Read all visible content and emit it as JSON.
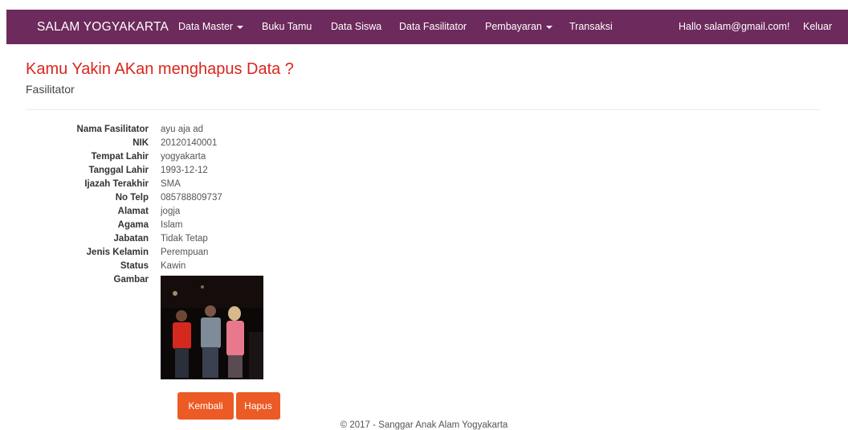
{
  "navbar": {
    "brand": "SALAM YOGYAKARTA",
    "items": [
      {
        "label": "Data Master",
        "dropdown": true
      },
      {
        "label": "Buku Tamu",
        "dropdown": false
      },
      {
        "label": "Data Siswa",
        "dropdown": false
      },
      {
        "label": "Data Fasilitator",
        "dropdown": false
      },
      {
        "label": "Pembayaran",
        "dropdown": true
      },
      {
        "label": "Transaksi",
        "dropdown": false
      }
    ],
    "greeting": "Hallo salam@gmail.com!",
    "logout": "Keluar"
  },
  "page": {
    "title": "Kamu Yakin AKan menghapus Data ?",
    "subtitle": "Fasilitator"
  },
  "detail": {
    "fields": [
      {
        "label": "Nama Fasilitator",
        "value": "ayu aja ad"
      },
      {
        "label": "NIK",
        "value": "20120140001"
      },
      {
        "label": "Tempat Lahir",
        "value": "yogyakarta"
      },
      {
        "label": "Tanggal Lahir",
        "value": "1993-12-12"
      },
      {
        "label": "Ijazah Terakhir",
        "value": "SMA"
      },
      {
        "label": "No Telp",
        "value": "085788809737"
      },
      {
        "label": "Alamat",
        "value": "jogja"
      },
      {
        "label": "Agama",
        "value": "Islam"
      },
      {
        "label": "Jabatan",
        "value": "Tidak Tetap"
      },
      {
        "label": "Jenis Kelamin",
        "value": "Perempuan"
      },
      {
        "label": "Status",
        "value": "Kawin"
      }
    ],
    "image_label": "Gambar"
  },
  "actions": {
    "back": "Kembali",
    "delete": "Hapus"
  },
  "footer": {
    "text": "© 2017 - Sanggar Anak Alam Yogyakarta"
  },
  "colors": {
    "navbar_bg": "#6d2a5c",
    "title": "#d9261c",
    "button_bg": "#ec5a25"
  }
}
